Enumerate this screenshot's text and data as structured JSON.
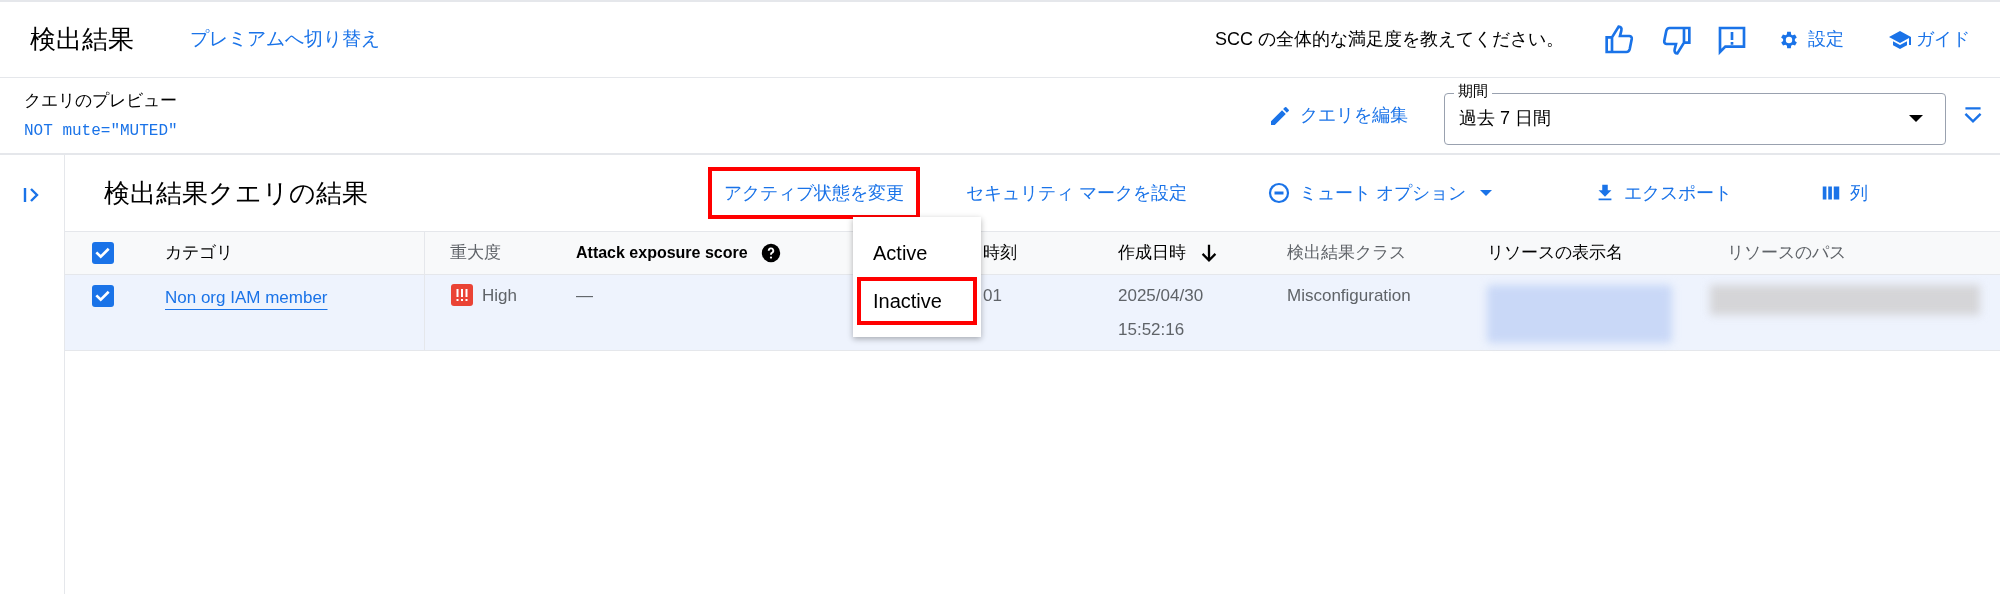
{
  "header": {
    "title": "検出結果",
    "premium_link": "プレミアムへ切り替え",
    "feedback_prompt": "SCC の全体的な満足度を教えてください。",
    "settings": "設定",
    "guide": "ガイド"
  },
  "query": {
    "label": "クエリのプレビュー",
    "code": "NOT mute=\"MUTED\"",
    "edit": "クエリを編集",
    "period_label": "期間",
    "period_value": "過去 7 日間"
  },
  "results": {
    "title": "検出結果クエリの結果",
    "actions": [
      {
        "label": "アクティブ状態を変更",
        "kind": "text",
        "highlighted": true
      },
      {
        "label": "セキュリティ マークを設定",
        "kind": "text",
        "highlighted": false
      },
      {
        "label": "ミュート オプション",
        "kind": "mute",
        "highlighted": false
      },
      {
        "label": "エクスポート",
        "kind": "export",
        "highlighted": false
      },
      {
        "label": "列",
        "kind": "columns",
        "highlighted": false
      }
    ],
    "menu": [
      {
        "label": "Active",
        "highlighted": false
      },
      {
        "label": "Inactive",
        "highlighted": true
      }
    ]
  },
  "table": {
    "all_checked": true,
    "columns": [
      {
        "label": "カテゴリ",
        "kind": "plain",
        "dim": false
      },
      {
        "label": "重大度",
        "kind": "plain",
        "dim": true
      },
      {
        "label": "Attack exposure score",
        "kind": "help",
        "dim": false
      },
      {
        "label": "時刻",
        "kind": "plain",
        "dim": false
      },
      {
        "label": "作成日時",
        "kind": "sorted",
        "dim": false
      },
      {
        "label": "検出結果クラス",
        "kind": "plain",
        "dim": true
      },
      {
        "label": "リソースの表示名",
        "kind": "plain",
        "dim": false
      },
      {
        "label": "リソースのパス",
        "kind": "plain",
        "dim": true
      }
    ],
    "rows": [
      {
        "checked": true,
        "category": "Non org IAM member",
        "severity": "High",
        "attack_score": "—",
        "time": "01",
        "created": [
          "2025/04/30",
          "15:52:16"
        ],
        "finding_class": "Misconfiguration"
      }
    ]
  }
}
